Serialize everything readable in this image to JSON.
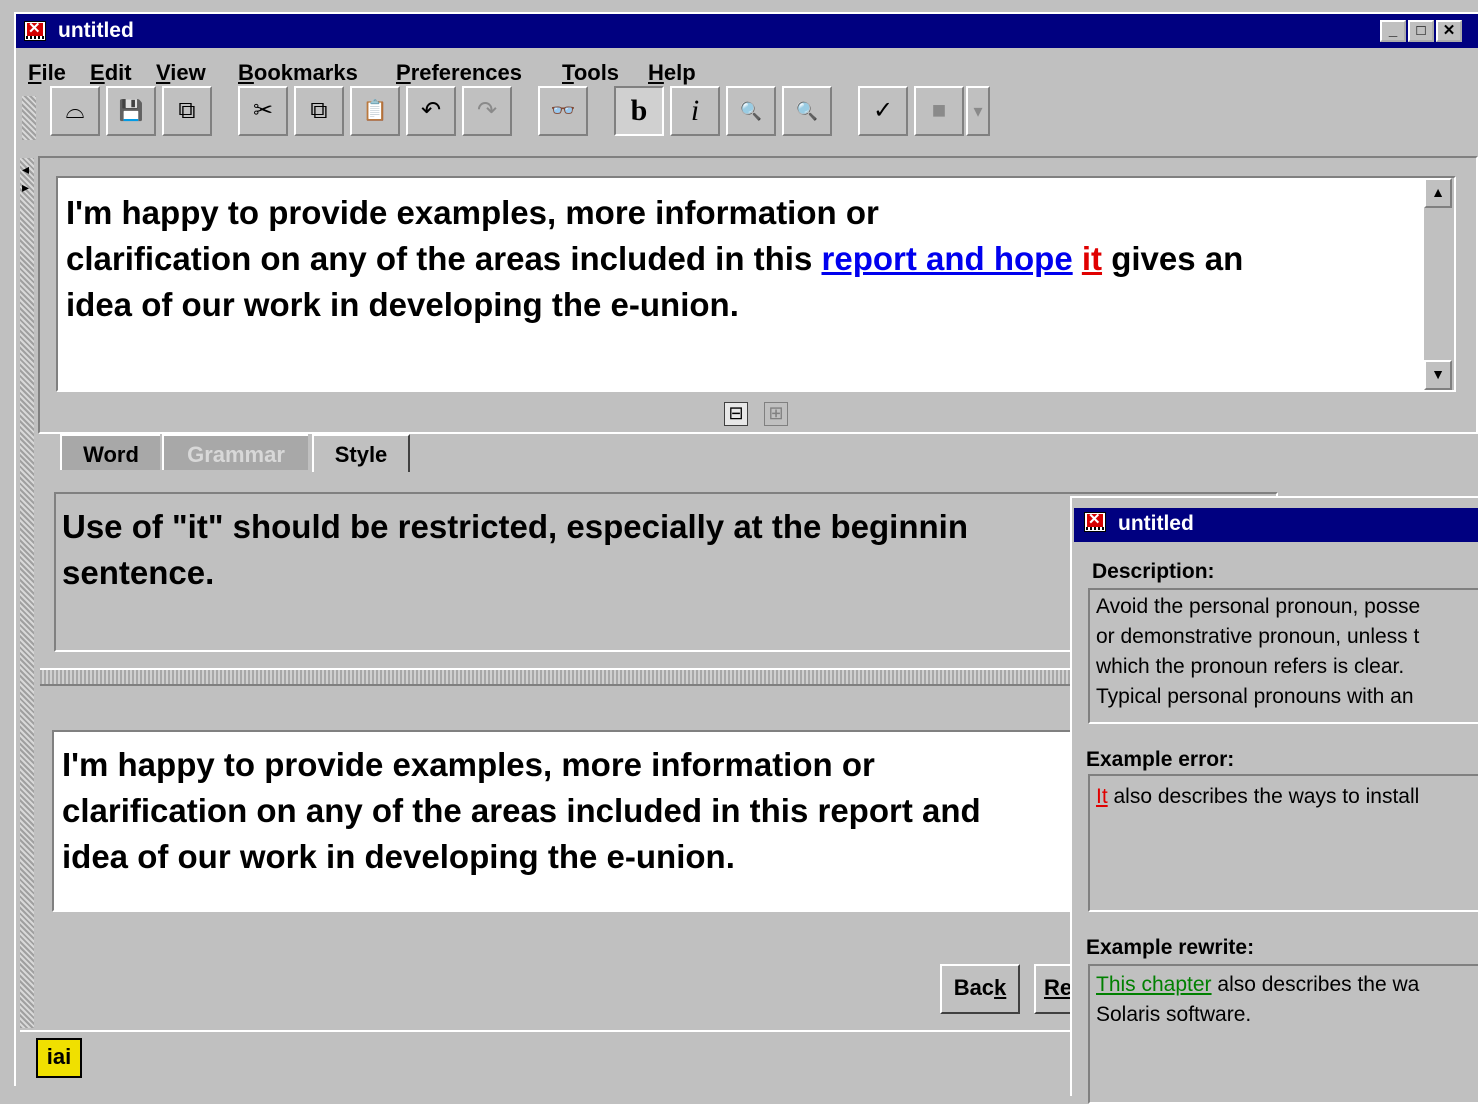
{
  "window": {
    "title": "untitled"
  },
  "menubar": {
    "items": [
      {
        "label": "File",
        "mnemonic": "F",
        "rest": "ile"
      },
      {
        "label": "Edit",
        "mnemonic": "E",
        "rest": "dit"
      },
      {
        "label": "View",
        "mnemonic": "V",
        "rest": "iew"
      },
      {
        "label": "Bookmarks",
        "mnemonic": "B",
        "rest": "ookmarks"
      },
      {
        "label": "Preferences",
        "mnemonic": "P",
        "rest": "references"
      },
      {
        "label": "Tools",
        "mnemonic": "T",
        "rest": "ools"
      },
      {
        "label": "Help",
        "mnemonic": "H",
        "rest": "elp"
      }
    ]
  },
  "toolbar": {
    "open_glyph": "⌓",
    "save_glyph": "💾",
    "saveas_glyph": "⧉",
    "cut_glyph": "✂",
    "copy_glyph": "⧉",
    "paste_glyph": "📋",
    "undo_glyph": "↶",
    "redo_glyph": "↷",
    "find_glyph": "👓",
    "bold_glyph": "b",
    "italic_glyph": "i",
    "zoomin_glyph": "🔍",
    "zoomout_glyph": "🔍",
    "check_glyph": "✓",
    "stop_glyph": "■",
    "dropdown_glyph": "▾"
  },
  "editor": {
    "line1": "I'm happy to provide examples, more information or",
    "line2_prefix": "clarification on any of the areas included in this ",
    "line2_link": "report and hope",
    "line2_space": " ",
    "line2_flag": "it",
    "line2_suffix": " gives an",
    "line3": "idea of our work in developing the e-union.",
    "collapse_glyph": "⊟",
    "expand_glyph": "⊞"
  },
  "tabs": {
    "word": "Word",
    "grammar": "Grammar",
    "style": "Style"
  },
  "message": {
    "text": "Use of \"it\" should be restricted, especially at the beginnin\nsentence."
  },
  "preview": {
    "line1": "I'm happy to provide examples, more information or",
    "line2": "clarification on any of the areas included in this report and",
    "line3": "idea of our work in developing the e-union."
  },
  "buttons": {
    "back_prefix": "Bac",
    "back_mnemonic": "k",
    "next_partial": "Re"
  },
  "status": {
    "logo": "iai"
  },
  "popup": {
    "title": "untitled",
    "description_label": "Description:",
    "description_text": "Avoid the personal pronoun, posse\nor demonstrative pronoun, unless t\nwhich the pronoun refers is clear.\nTypical personal pronouns with an",
    "example_error_label": "Example error:",
    "example_error_flag": "It",
    "example_error_rest": " also describes the ways to install",
    "example_rewrite_label": "Example rewrite:",
    "example_rewrite_fix": "This chapter",
    "example_rewrite_rest": " also describes the wa",
    "example_rewrite_line2": "Solaris software.",
    "colors": {
      "error": "#e00000",
      "fix": "#008000"
    }
  }
}
